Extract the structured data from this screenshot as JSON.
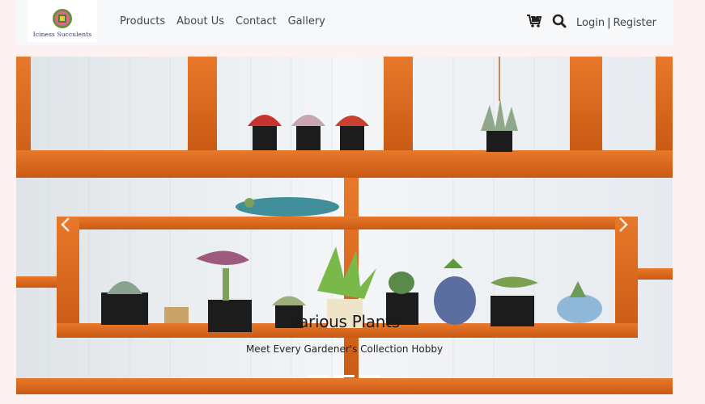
{
  "brand": {
    "name": "Iciness Succulents"
  },
  "nav": {
    "links": [
      "Products",
      "About Us",
      "Contact",
      "Gallery"
    ]
  },
  "actions": {
    "login": "Login",
    "separator": "|",
    "register": "Register"
  },
  "carousel": {
    "title": "Various Plants",
    "subtitle": "Meet Every Gardener's Collection Hobby",
    "slide_count": 3,
    "active_slide": 2
  },
  "colors": {
    "navbar_bg": "#f7f8fa",
    "page_bg": "#fdf2f1",
    "wood": "#d9691f",
    "text": "#3f4650"
  },
  "icons": [
    "cart-icon",
    "search-icon",
    "chevron-left-icon",
    "chevron-right-icon"
  ]
}
